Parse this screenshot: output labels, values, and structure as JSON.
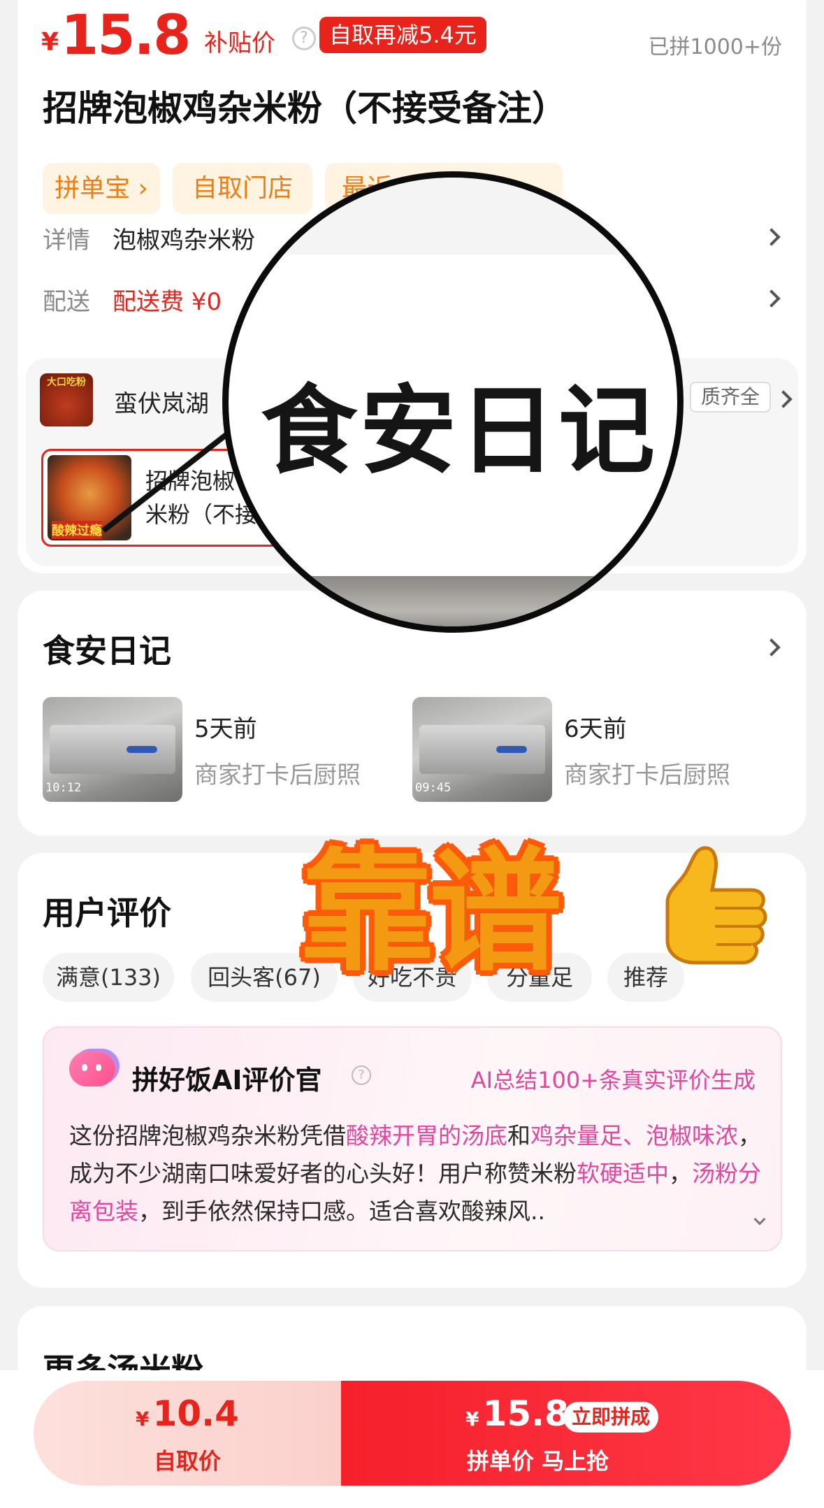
{
  "header": {
    "currency": "¥",
    "price": "15.8",
    "price_label": "补贴价",
    "help_icon": "question-circle-icon",
    "discount_badge": "自取再减5.4元",
    "sold_count": "已拼1000+份"
  },
  "product": {
    "title": "招牌泡椒鸡杂米粉（不接受备注）",
    "chips": [
      "拼单宝",
      "自取门店",
      "最近"
    ],
    "detail_label": "详情",
    "detail_value": "泡椒鸡杂米粉",
    "delivery_label": "配送",
    "delivery_value": "配送费 ¥0"
  },
  "store": {
    "logo_text": "大口吃粉",
    "name": "蛮伏岚湖",
    "qual_badge": "质齐全",
    "item_name_line1": "招牌泡椒",
    "item_name_line2": "米粉（不接",
    "item_thumb_text": "酸辣过瘾"
  },
  "magnifier": {
    "text": "食安日记"
  },
  "diary": {
    "title": "食安日记",
    "entries": [
      {
        "time": "5天前",
        "desc": "商家打卡后厨照",
        "stamp": "10:12"
      },
      {
        "time": "6天前",
        "desc": "商家打卡后厨照",
        "stamp": "09:45"
      }
    ]
  },
  "reviews": {
    "title": "用户评价",
    "tags": [
      "满意(133)",
      "回头客(67)",
      "好吃不贵",
      "分量足",
      "推荐"
    ],
    "ai": {
      "title": "拼好饭AI评价官",
      "summary_note": "AI总结100+条真实评价生成",
      "text_1": "这份招牌泡椒鸡杂米粉凭借",
      "hl_1": "酸辣开胃的汤底",
      "text_2": "和",
      "hl_2": "鸡杂量足、泡椒味浓",
      "text_3": "，成为不少湖南口味爱好者的心头好！用户称赞米粉",
      "hl_3": "软硬适中",
      "text_4": "，",
      "hl_4": "汤粉分离包装",
      "text_5": "，到手依然保持口感。适合喜欢酸辣风.."
    }
  },
  "overlay": {
    "big_text": "靠谱",
    "thumb_icon": "thumbs-up-icon"
  },
  "more": {
    "title": "更多汤米粉"
  },
  "bottom_bar": {
    "pickup_currency": "¥",
    "pickup_price": "10.4",
    "pickup_label": "自取价",
    "group_currency": "¥",
    "group_price": "15.8",
    "group_badge": "立即拼成",
    "group_label": "拼单价 马上抢"
  },
  "colors": {
    "price_red": "#e8231c",
    "chip_orange": "#ef7d14",
    "ai_pink": "#e0479e"
  }
}
